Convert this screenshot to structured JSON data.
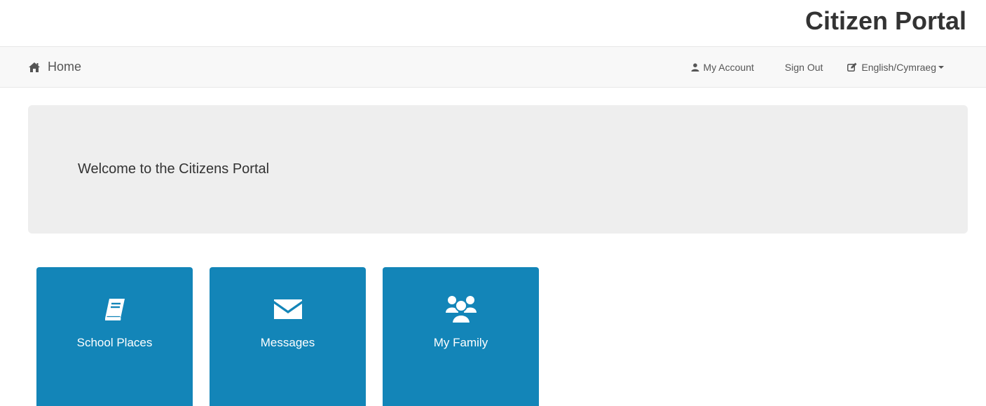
{
  "header": {
    "site_title": "Citizen Portal"
  },
  "navbar": {
    "home_label": "Home",
    "account_label": "My Account",
    "signout_label": "Sign Out",
    "language_label": "English/Cymraeg"
  },
  "jumbotron": {
    "welcome_text": "Welcome to the Citizens Portal"
  },
  "tiles": [
    {
      "label": "School Places",
      "icon": "book-icon"
    },
    {
      "label": "Messages",
      "icon": "envelope-icon"
    },
    {
      "label": "My Family",
      "icon": "users-icon"
    }
  ],
  "colors": {
    "tile_background": "#1385b8",
    "navbar_background": "#f8f8f8",
    "jumbotron_background": "#eeeeee"
  }
}
